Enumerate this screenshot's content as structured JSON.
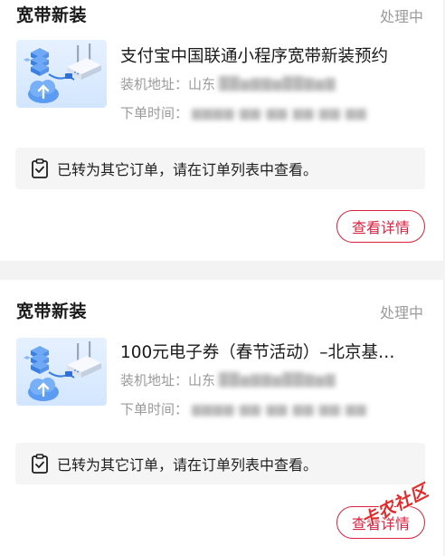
{
  "orders": [
    {
      "type": "宽带新装",
      "status": "处理中",
      "title": "支付宝中国联通小程序宽带新装预约",
      "address_label": "装机地址：",
      "address_visible": "山东",
      "time_label": "下单时间：",
      "notice_text": "已转为其它订单，请在订单列表中查看。",
      "detail_label": "查看详情"
    },
    {
      "type": "宽带新装",
      "status": "处理中",
      "title": "100元电子券（春节活动）–北京基…",
      "address_label": "装机地址：",
      "address_visible": "山东",
      "time_label": "下单时间：",
      "notice_text": "已转为其它订单，请在订单列表中查看。",
      "detail_label": "查看详情"
    }
  ],
  "watermark": "卡农社区",
  "colors": {
    "accent": "#d9223f",
    "muted_text": "#9a9a9a",
    "notice_bg": "#f5f5f5",
    "page_bg": "#f3f3f3"
  },
  "icons": {
    "product_thumbnail": "router-broadband-icon",
    "notice": "clipboard-check-icon"
  }
}
